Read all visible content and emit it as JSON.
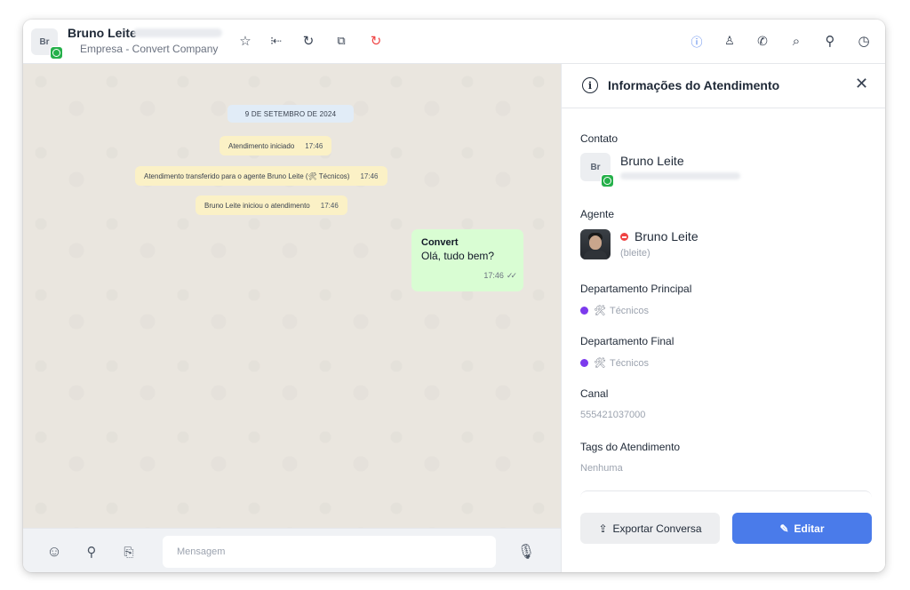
{
  "header": {
    "avatar_initials": "Br",
    "contact_name": "Bruno Leite",
    "contact_company": "Empresa - Convert Company",
    "left_icons": [
      "star-icon",
      "transfer-icon",
      "refresh-icon",
      "copy-icon",
      "close-chat-icon"
    ],
    "right_icons": [
      "info-icon",
      "user-icon",
      "phone-icon",
      "search-icon",
      "attach-icon",
      "clock-icon"
    ]
  },
  "chat": {
    "date": "9 DE SETEMBRO DE 2024",
    "system_messages": [
      {
        "text": "Atendimento iniciado",
        "time": "17:46"
      },
      {
        "text": "Atendimento transferido para o agente Bruno Leite (🛠 Técnicos)",
        "time": "17:46"
      },
      {
        "text": "Bruno Leite iniciou o atendimento",
        "time": "17:46"
      }
    ],
    "message": {
      "sender": "Convert",
      "text": "Olá, tudo bem?",
      "time": "17:46"
    },
    "accent_color": "#d9fdd3"
  },
  "composer": {
    "placeholder": "Mensagem",
    "icons": [
      "emoji-icon",
      "attach-icon",
      "quick-reply-icon",
      "microphone-icon"
    ]
  },
  "panel": {
    "title": "Informações do Atendimento",
    "contact_label": "Contato",
    "contact_initials": "Br",
    "contact_name": "Bruno Leite",
    "agent_label": "Agente",
    "agent_name": "Bruno Leite",
    "agent_username": "(bleite)",
    "agent_status_color": "#ef4444",
    "dept_main_label": "Departamento Principal",
    "dept_main_value": "Técnicos",
    "dept_final_label": "Departamento Final",
    "dept_final_value": "Técnicos",
    "dept_color": "#7c3aed",
    "channel_label": "Canal",
    "channel_value": "555421037000",
    "tags_label": "Tags do Atendimento",
    "tags_value": "Nenhuma",
    "export_label": "Exportar Conversa",
    "edit_label": "Editar",
    "edit_color": "#4a7bea"
  }
}
